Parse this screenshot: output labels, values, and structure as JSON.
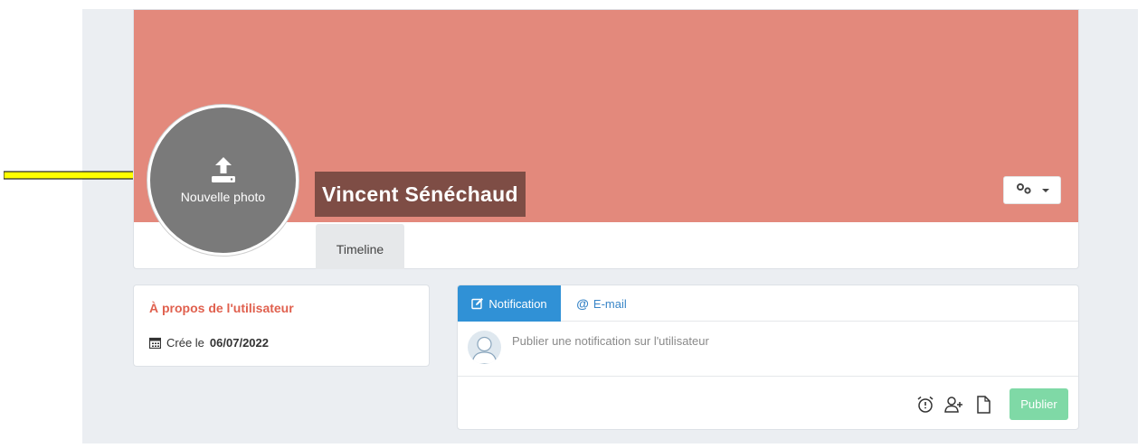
{
  "profile": {
    "name": "Vincent Sénéchaud",
    "avatar_label": "Nouvelle photo",
    "tabs": [
      {
        "label": "Timeline"
      }
    ],
    "cover_color": "#e3897c"
  },
  "about": {
    "title": "À propos de l'utilisateur",
    "created_prefix": "Crée le",
    "created_date": "06/07/2022"
  },
  "post": {
    "tabs": [
      {
        "label": "Notification",
        "icon": "edit-icon",
        "active": true
      },
      {
        "label": "E-mail",
        "icon": "at-icon",
        "active": false
      }
    ],
    "placeholder": "Publier une notification sur l'utilisateur",
    "action_icons": [
      "alarm-clock-icon",
      "add-user-icon",
      "file-icon"
    ],
    "publish_label": "Publier"
  },
  "colors": {
    "accent": "#3091d6",
    "title_red": "#e0604e",
    "publish_green": "#7fd9a6",
    "name_bg": "#7e4d45"
  }
}
